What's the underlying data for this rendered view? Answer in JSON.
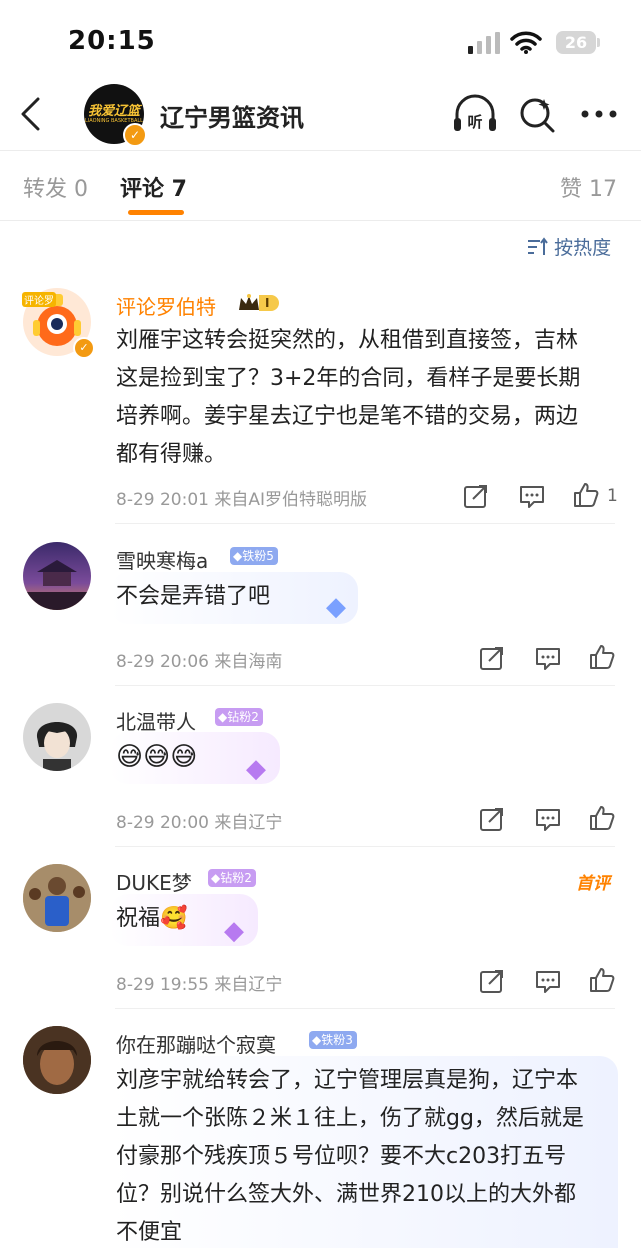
{
  "status_bar": {
    "time": "20:15",
    "battery": "26"
  },
  "header": {
    "title": "辽宁男篮资讯",
    "avatar_text": "我爱辽篮",
    "avatar_sub": "LIAONING BASKETBALL",
    "listen_label": "听"
  },
  "tabs": {
    "repost": "转发 0",
    "comment": "评论 7",
    "like": "赞 17"
  },
  "sort_label": "按热度",
  "comments": [
    {
      "user": "评论罗伯特",
      "badge": "I",
      "avatar_tag": "评论罗",
      "text": "刘雁宇这转会挺突然的，从租借到直接签，吉林这是捡到宝了？3+2年的合同，看样子是要长期培养啊。姜宇星去辽宁也是笔不错的交易，两边都有得赚。",
      "meta": "8-29 20:01  来自AI罗伯特聪明版",
      "likes": "1"
    },
    {
      "user": "雪映寒梅a",
      "badge": "铁粉5",
      "text": "不会是弄错了吧",
      "meta": "8-29 20:06  来自海南"
    },
    {
      "user": "北温带人",
      "badge": "钻粉2",
      "text": "😅😅😅",
      "meta": "8-29 20:00  来自辽宁"
    },
    {
      "user": "DUKE梦",
      "badge": "钻粉2",
      "text": "祝福🥰",
      "meta": "8-29 19:55  来自辽宁",
      "tag": "首评"
    },
    {
      "user": "你在那蹦哒个寂寞",
      "badge": "铁粉3",
      "text": "刘彦宇就给转会了，辽宁管理层真是狗，辽宁本土就一个张陈２米１往上，伤了就gg，然后就是付豪那个残疾顶５号位呗？要不大c203打五号位？别说什么签大外、满世界210以上的大外都不便宜"
    }
  ],
  "colors": {
    "accent": "#ff8200",
    "link": "#4a6c9a",
    "badge_blue": "#8ea9f0",
    "badge_purple": "#c79cf2"
  }
}
